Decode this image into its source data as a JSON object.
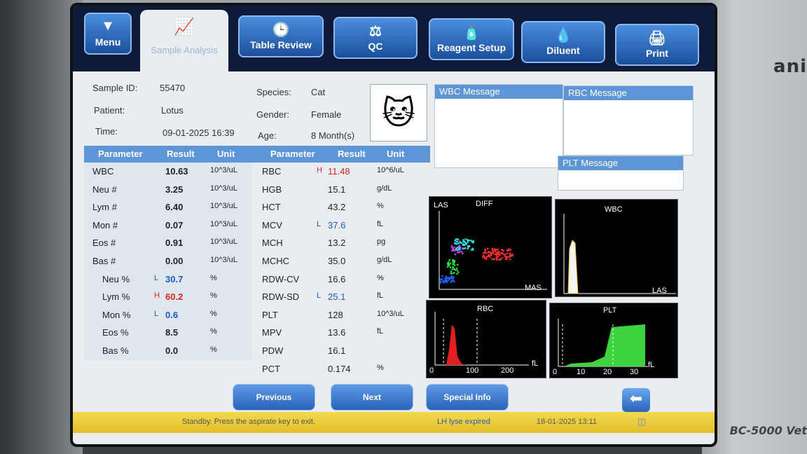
{
  "device": {
    "brand": "ani",
    "model": "BC-5000 Vet"
  },
  "toolbar": {
    "menu": "Menu",
    "sample_analysis": "Sample Analysis",
    "table_review": "Table Review",
    "qc": "QC",
    "reagent_setup": "Reagent Setup",
    "diluent": "Diluent",
    "print": "Print"
  },
  "info": {
    "sample_id_label": "Sample ID:",
    "sample_id": "55470",
    "patient_label": "Patient:",
    "patient": "Lotus",
    "time_label": "Time:",
    "time": "09-01-2025 16:39",
    "species_label": "Species:",
    "species": "Cat",
    "gender_label": "Gender:",
    "gender": "Female",
    "age_label": "Age:",
    "age": "8 Month(s)"
  },
  "messages": {
    "wbc": "WBC Message",
    "rbc": "RBC Message",
    "plt": "PLT Message"
  },
  "table": {
    "headers": [
      "Parameter",
      "Result",
      "Unit",
      "Parameter",
      "Result",
      "Unit"
    ],
    "left": [
      {
        "p": "WBC",
        "f": "",
        "r": "10.63",
        "u": "10^3/uL"
      },
      {
        "p": "Neu #",
        "f": "",
        "r": "3.25",
        "u": "10^3/uL"
      },
      {
        "p": "Lym #",
        "f": "",
        "r": "6.40",
        "u": "10^3/uL"
      },
      {
        "p": "Mon #",
        "f": "",
        "r": "0.07",
        "u": "10^3/uL"
      },
      {
        "p": "Eos #",
        "f": "",
        "r": "0.91",
        "u": "10^3/uL"
      },
      {
        "p": "Bas #",
        "f": "",
        "r": "0.00",
        "u": "10^3/uL"
      },
      {
        "p": "Neu %",
        "f": "L",
        "r": "30.7",
        "u": "%"
      },
      {
        "p": "Lym %",
        "f": "H",
        "r": "60.2",
        "u": "%"
      },
      {
        "p": "Mon %",
        "f": "L",
        "r": "0.6",
        "u": "%"
      },
      {
        "p": "Eos %",
        "f": "",
        "r": "8.5",
        "u": "%"
      },
      {
        "p": "Bas %",
        "f": "",
        "r": "0.0",
        "u": "%"
      }
    ],
    "right": [
      {
        "p": "RBC",
        "f": "H",
        "r": "11.48",
        "u": "10^6/uL"
      },
      {
        "p": "HGB",
        "f": "",
        "r": "15.1",
        "u": "g/dL"
      },
      {
        "p": "HCT",
        "f": "",
        "r": "43.2",
        "u": "%"
      },
      {
        "p": "MCV",
        "f": "L",
        "r": "37.6",
        "u": "fL"
      },
      {
        "p": "MCH",
        "f": "",
        "r": "13.2",
        "u": "pg"
      },
      {
        "p": "MCHC",
        "f": "",
        "r": "35.0",
        "u": "g/dL"
      },
      {
        "p": "RDW-CV",
        "f": "",
        "r": "16.6",
        "u": "%"
      },
      {
        "p": "RDW-SD",
        "f": "L",
        "r": "25.1",
        "u": "fL"
      },
      {
        "p": "PLT",
        "f": "",
        "r": "128",
        "u": "10^3/uL"
      },
      {
        "p": "MPV",
        "f": "",
        "r": "13.6",
        "u": "fL"
      },
      {
        "p": "PDW",
        "f": "",
        "r": "16.1",
        "u": ""
      },
      {
        "p": "PCT",
        "f": "",
        "r": "0.174",
        "u": "%"
      }
    ]
  },
  "graphs": {
    "diff": {
      "title": "DIFF",
      "y": "LAS",
      "x": "MAS"
    },
    "wbc": {
      "title": "WBC",
      "x": "LAS"
    },
    "rbc": {
      "title": "RBC",
      "ticks": [
        "0",
        "100",
        "200"
      ],
      "unit": "fL"
    },
    "plt": {
      "title": "PLT",
      "ticks": [
        "0",
        "10",
        "20",
        "30"
      ],
      "unit": "fL"
    }
  },
  "buttons": {
    "previous": "Previous",
    "next": "Next",
    "special_info": "Special Info"
  },
  "status": {
    "message": "Standby. Press the aspirate key to exit.",
    "alert": "LH lyse expired",
    "datetime": "18-01-2025 13:11"
  }
}
